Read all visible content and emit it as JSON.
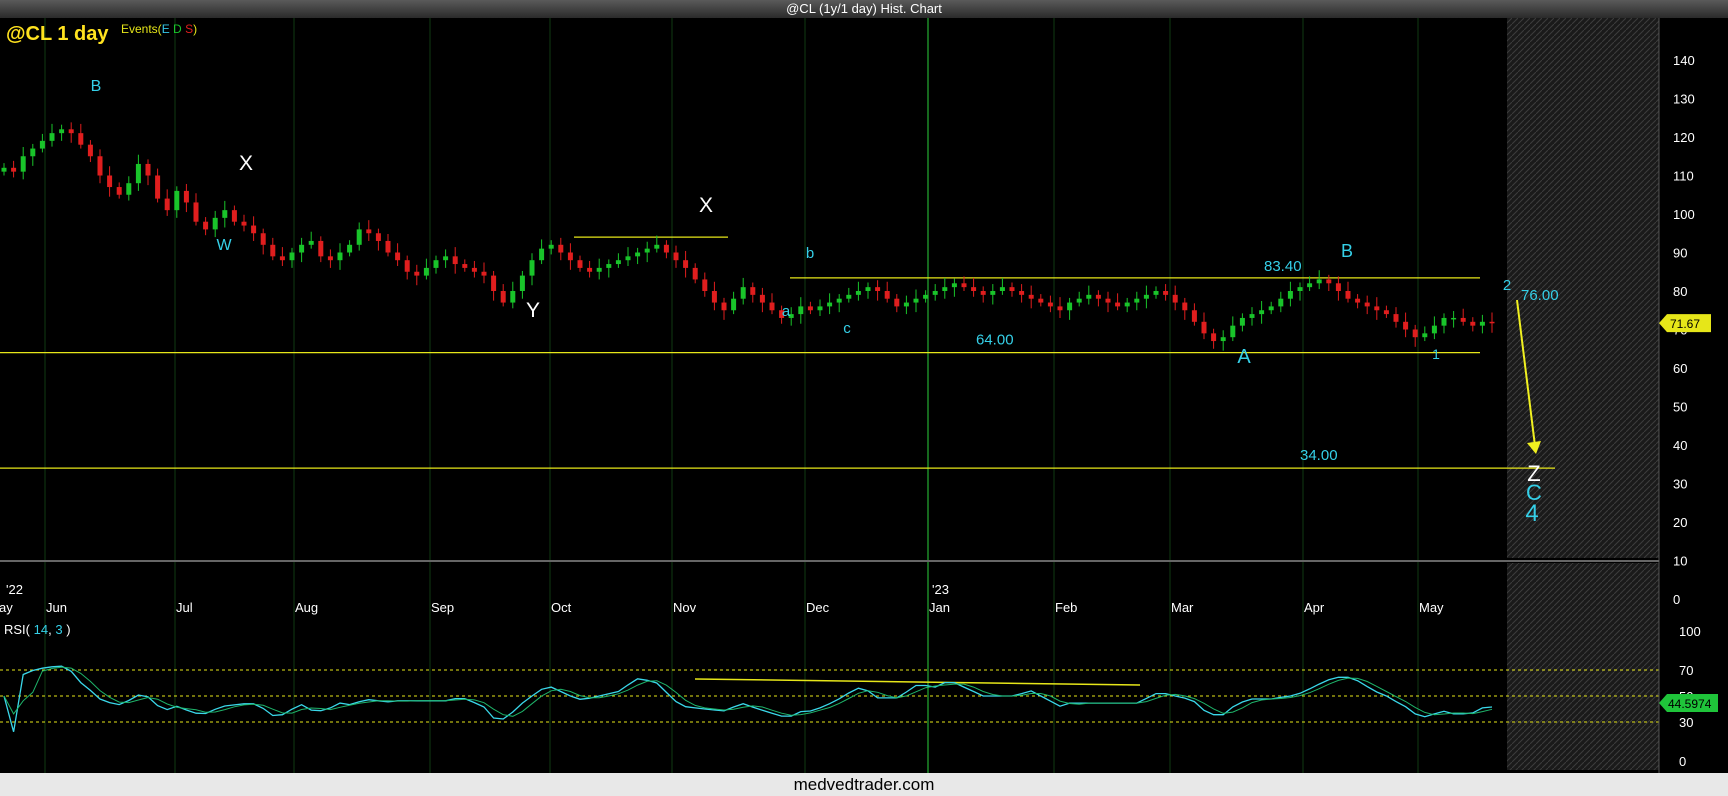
{
  "window_title": "@CL (1y/1 day) Hist. Chart",
  "footer_text": "medvedtrader.com",
  "colors": {
    "up": "#19c42a",
    "down": "#e01e1e",
    "level": "#e6e619",
    "cyan": "#35d0e8",
    "rsi": "#3ad8ea",
    "rsi_avg": "#1eb46a"
  },
  "chart_data": [
    {
      "type": "candlestick",
      "title": "@CL 1 day",
      "events_label": {
        "prefix": "Events(",
        "e": "E",
        "d": "D",
        "s": "S",
        "suffix": ")"
      },
      "y_ticks": [
        140,
        130,
        120,
        110,
        100,
        90,
        80,
        70,
        60,
        50,
        40,
        30,
        20,
        10,
        0
      ],
      "ylim": [
        0,
        140
      ],
      "x_labels": [
        "ay",
        "Jun",
        "Jul",
        "Aug",
        "Sep",
        "Oct",
        "Nov",
        "Dec",
        "Jan",
        "Feb",
        "Mar",
        "Apr",
        "May"
      ],
      "year_labels": [
        "'22",
        "'23"
      ],
      "last_price": "71.67",
      "closes": [
        112,
        111,
        115,
        117,
        119,
        121,
        122,
        121,
        118,
        115,
        110,
        107,
        105,
        108,
        113,
        110,
        104,
        101,
        106,
        103,
        98,
        96,
        99,
        101,
        98,
        97,
        95,
        92,
        89,
        88,
        90,
        92,
        93,
        89,
        88,
        90,
        92,
        96,
        95,
        93,
        90,
        88,
        85,
        84,
        86,
        88,
        89,
        87,
        86,
        85,
        84,
        80,
        77,
        80,
        84,
        88,
        91,
        92,
        90,
        88,
        86,
        85,
        86,
        87,
        88,
        89,
        90,
        91,
        92,
        90,
        88,
        86,
        83,
        80,
        77,
        75,
        78,
        81,
        79,
        77,
        75,
        73,
        74,
        76,
        75,
        76,
        77,
        78,
        79,
        80,
        81,
        80,
        78,
        76,
        77,
        78,
        79,
        80,
        81,
        82,
        81,
        80,
        79,
        80,
        81,
        80,
        79,
        78,
        77,
        76,
        75,
        77,
        78,
        79,
        78,
        77,
        76,
        77,
        78,
        79,
        80,
        79,
        77,
        75,
        72,
        69,
        67,
        68,
        71,
        73,
        74,
        75,
        76,
        78,
        80,
        81,
        82,
        83,
        82,
        80,
        78,
        77,
        76,
        75,
        74,
        72,
        70,
        68,
        69,
        71,
        73,
        73,
        72,
        71,
        72,
        71.67
      ],
      "levels": [
        {
          "value": 94,
          "label": ""
        },
        {
          "value": 83.4,
          "label": "83.40"
        },
        {
          "value": 64,
          "label": "64.00"
        },
        {
          "value": 34,
          "label": "34.00"
        }
      ],
      "target_label": "76.00",
      "wave_labels": [
        {
          "text": "B",
          "color": "cyan"
        },
        {
          "text": "X",
          "color": "white"
        },
        {
          "text": "W",
          "color": "cyan"
        },
        {
          "text": "Y",
          "color": "white"
        },
        {
          "text": "X",
          "color": "white"
        },
        {
          "text": "a",
          "color": "cyan"
        },
        {
          "text": "b",
          "color": "cyan"
        },
        {
          "text": "c",
          "color": "cyan"
        },
        {
          "text": "B",
          "color": "cyan"
        },
        {
          "text": "A",
          "color": "cyan"
        },
        {
          "text": "1",
          "color": "cyan"
        },
        {
          "text": "2",
          "color": "cyan"
        },
        {
          "text": "Z",
          "color": "white"
        },
        {
          "text": "C",
          "color": "cyan"
        },
        {
          "text": "4",
          "color": "cyan"
        }
      ]
    },
    {
      "type": "line",
      "title": "RSI( 14, 3 )",
      "rsi_label": {
        "prefix": "RSI(",
        "period": "14",
        "smooth": "3",
        "suffix": ")"
      },
      "y_ticks": [
        100,
        70,
        50,
        30,
        0
      ],
      "ylim": [
        0,
        100
      ],
      "guides": [
        70,
        50,
        30
      ],
      "last_value": "44.5974"
    }
  ]
}
